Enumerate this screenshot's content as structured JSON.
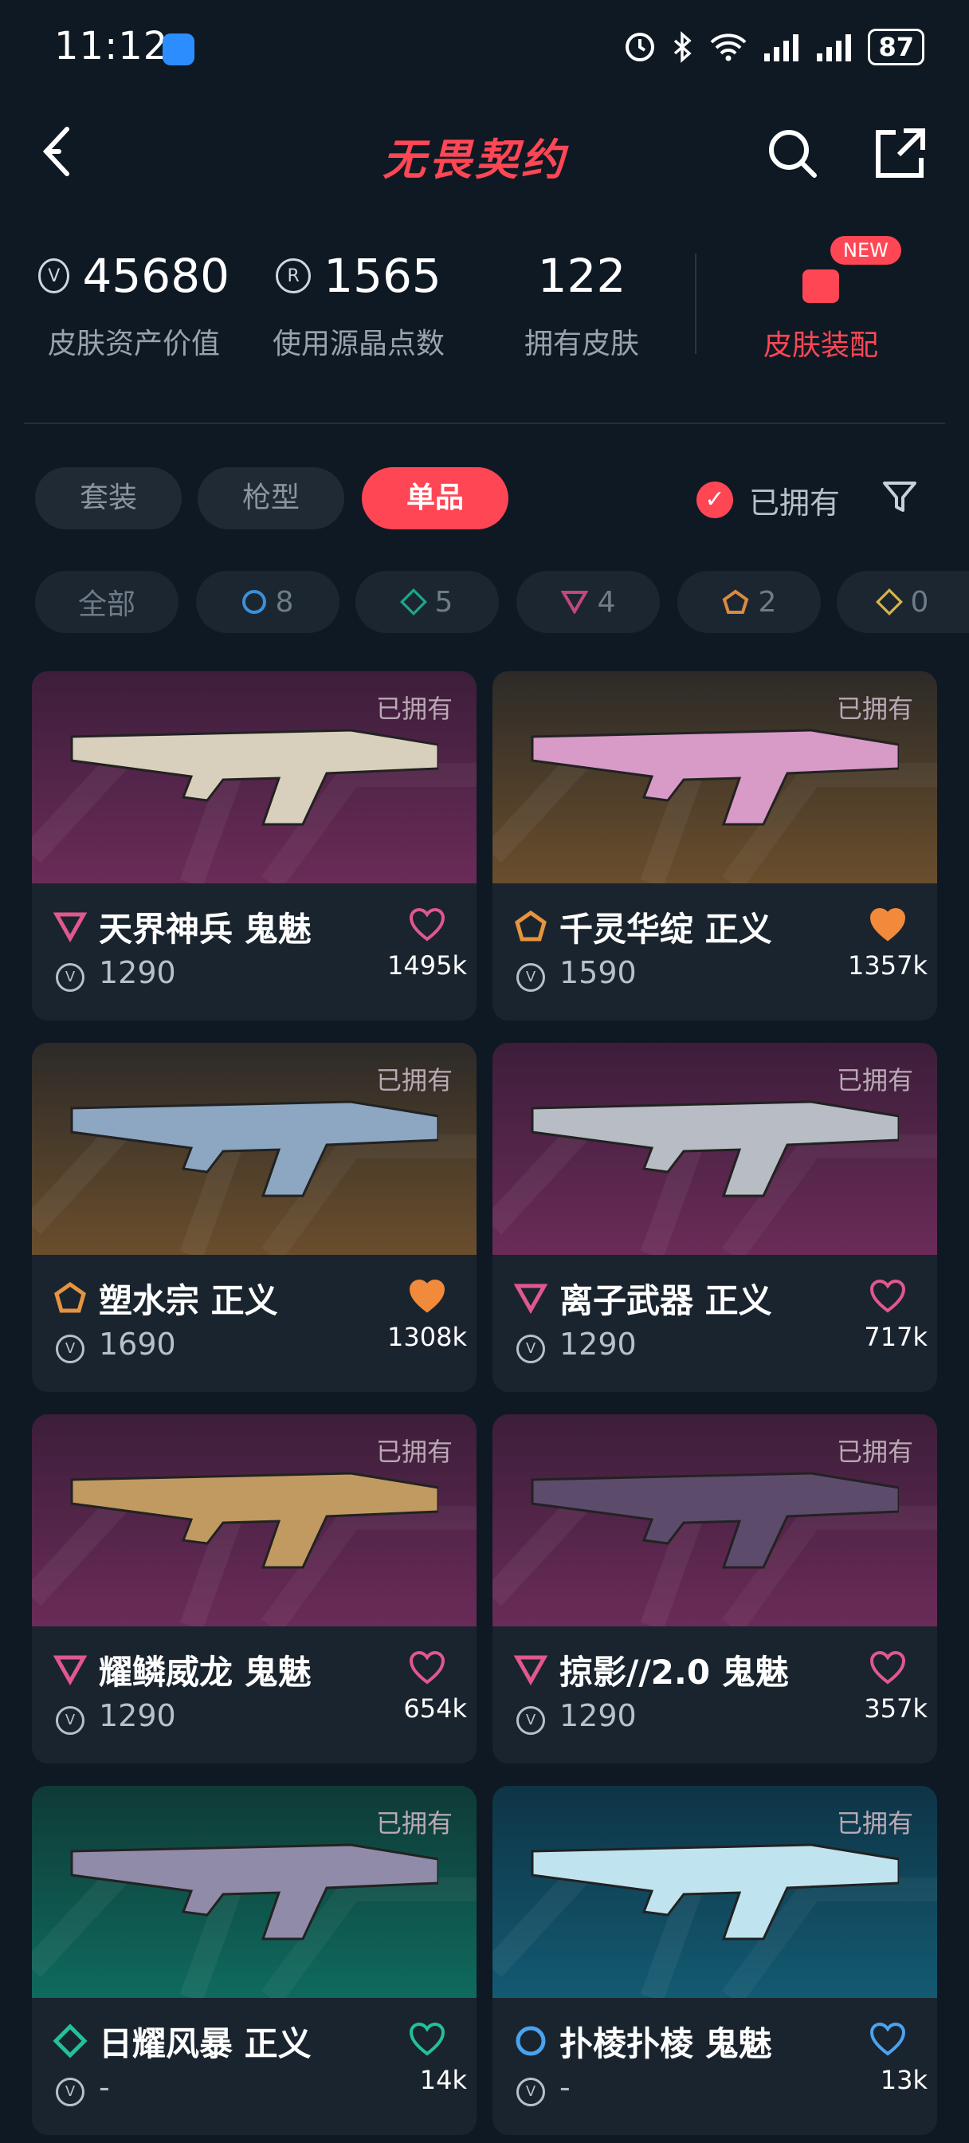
{
  "status_bar": {
    "time": "11:12",
    "battery": "87",
    "signal_sup": "6"
  },
  "header": {
    "title": "无畏契约"
  },
  "stats": [
    {
      "value": "45680",
      "label": "皮肤资产价值",
      "icon": "vp-coin-icon"
    },
    {
      "value": "1565",
      "label": "使用源晶点数",
      "icon": "radianite-icon"
    },
    {
      "value": "122",
      "label": "拥有皮肤",
      "icon": ""
    }
  ],
  "skin_outfit": {
    "label": "皮肤装配",
    "badge": "NEW"
  },
  "tabs": [
    {
      "label": "套装"
    },
    {
      "label": "枪型"
    },
    {
      "label": "单品"
    }
  ],
  "filter": {
    "owned_label": "已拥有",
    "owned_checked": true
  },
  "rarity_chips": [
    {
      "label": "全部"
    },
    {
      "count": "8",
      "tier": "select",
      "color": "#3d8fd6"
    },
    {
      "count": "5",
      "tier": "deluxe",
      "color": "#1aa88a"
    },
    {
      "count": "4",
      "tier": "premium",
      "color": "#c2477f"
    },
    {
      "count": "2",
      "tier": "exclusive",
      "color": "#d98b3e"
    },
    {
      "count": "0",
      "tier": "ultra",
      "color": "#d7b448"
    }
  ],
  "cards": [
    {
      "name": "天界神兵 鬼魅",
      "price": "1290",
      "likes": "1495k",
      "owned": "已拥有",
      "tier": "premium",
      "favorited": false
    },
    {
      "name": "千灵华绽 正义",
      "price": "1590",
      "likes": "1357k",
      "owned": "已拥有",
      "tier": "exclusive",
      "favorited": true
    },
    {
      "name": "塑水宗 正义",
      "price": "1690",
      "likes": "1308k",
      "owned": "已拥有",
      "tier": "exclusive",
      "favorited": true
    },
    {
      "name": "离子武器 正义",
      "price": "1290",
      "likes": "717k",
      "owned": "已拥有",
      "tier": "premium",
      "favorited": false
    },
    {
      "name": "耀鳞威龙 鬼魅",
      "price": "1290",
      "likes": "654k",
      "owned": "已拥有",
      "tier": "premium",
      "favorited": false
    },
    {
      "name": "掠影//2.0 鬼魅",
      "price": "1290",
      "likes": "357k",
      "owned": "已拥有",
      "tier": "premium",
      "favorited": false
    },
    {
      "name": "日耀风暴 正义",
      "price": "-",
      "likes": "14k",
      "owned": "已拥有",
      "tier": "deluxe",
      "favorited": false
    },
    {
      "name": "扑棱扑棱 鬼魅",
      "price": "-",
      "likes": "13k",
      "owned": "已拥有",
      "tier": "select",
      "favorited": false
    }
  ]
}
